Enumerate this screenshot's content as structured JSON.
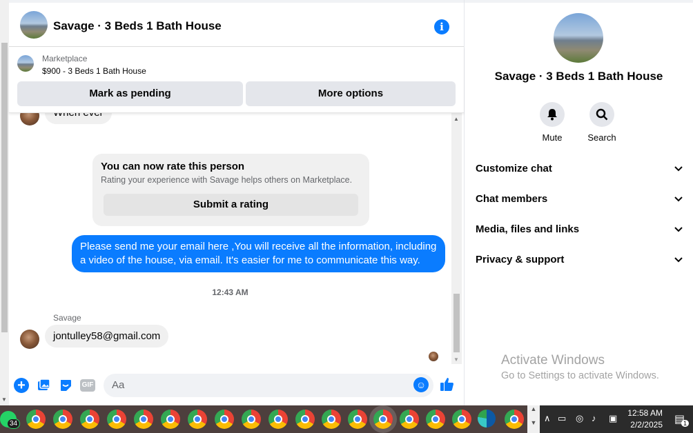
{
  "chat": {
    "title": "Savage · 3 Beds 1 Bath House",
    "marketplace": {
      "label": "Marketplace",
      "listing": "$900 - 3 Beds 1 Bath House",
      "pending_btn": "Mark as pending",
      "more_btn": "More options"
    },
    "messages": {
      "partial_text": "When ever",
      "rate_title": "You can now rate this person",
      "rate_sub": "Rating your experience with Savage helps others on Marketplace.",
      "rate_btn": "Submit a rating",
      "outgoing": "Please send me your email here ,You will receive all the information, including a video of the house, via email. It's easier for me to communicate this way.",
      "timestamp": "12:43 AM",
      "sender": "Savage",
      "email_msg": "jontulley58@gmail.com"
    },
    "composer": {
      "placeholder": "Aa",
      "gif": "GIF"
    }
  },
  "panel": {
    "title": "Savage · 3 Beds 1 Bath House",
    "mute": "Mute",
    "search": "Search",
    "sections": [
      "Customize chat",
      "Chat members",
      "Media, files and links",
      "Privacy & support"
    ]
  },
  "watermark": {
    "line1": "Activate Windows",
    "line2": "Go to Settings to activate Windows."
  },
  "taskbar": {
    "whatsapp_badge": "34",
    "time": "12:58 AM",
    "date": "2/2/2025",
    "notif_count": "1"
  },
  "colors": {
    "accent": "#0a7cff",
    "bubble_in": "#f0f0f0",
    "button_bg": "#e4e6eb"
  }
}
